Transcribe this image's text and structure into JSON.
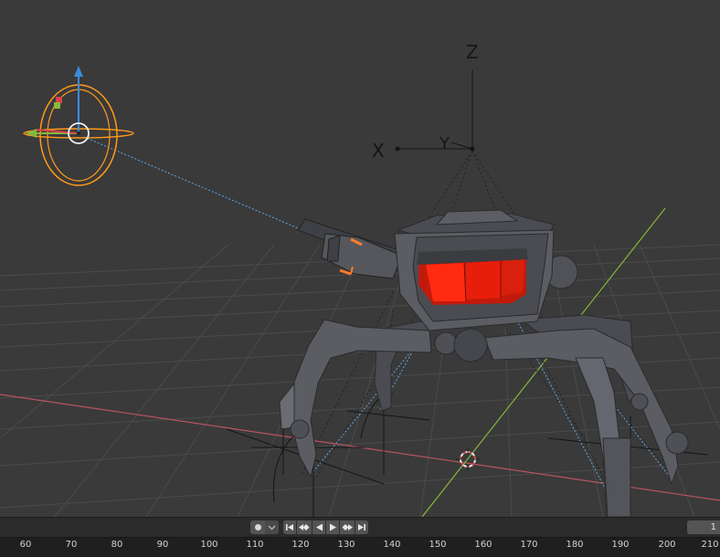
{
  "viewport": {
    "axis_labels": {
      "x": "X",
      "y": "Y",
      "z": "Z"
    }
  },
  "timeline": {
    "record_icon": "record-dot-icon",
    "record_menu_icon": "chevron-down-icon",
    "playback_icons": [
      "jump-to-start-icon",
      "prev-keyframe-icon",
      "play-reverse-icon",
      "play-icon",
      "next-keyframe-icon",
      "jump-to-end-icon"
    ],
    "current_frame": "1",
    "ruler_ticks": [
      "60",
      "70",
      "80",
      "90",
      "100",
      "110",
      "120",
      "130",
      "140",
      "150",
      "160",
      "170",
      "180",
      "190",
      "200",
      "210"
    ]
  },
  "colors": {
    "background": "#3a3a3a",
    "grid": "#4a4a4a",
    "x_axis": "#b8555f",
    "y_axis": "#86b83a",
    "light": "#ff9a1a",
    "glow": "#ff2a10",
    "body": "#5b5d62"
  }
}
